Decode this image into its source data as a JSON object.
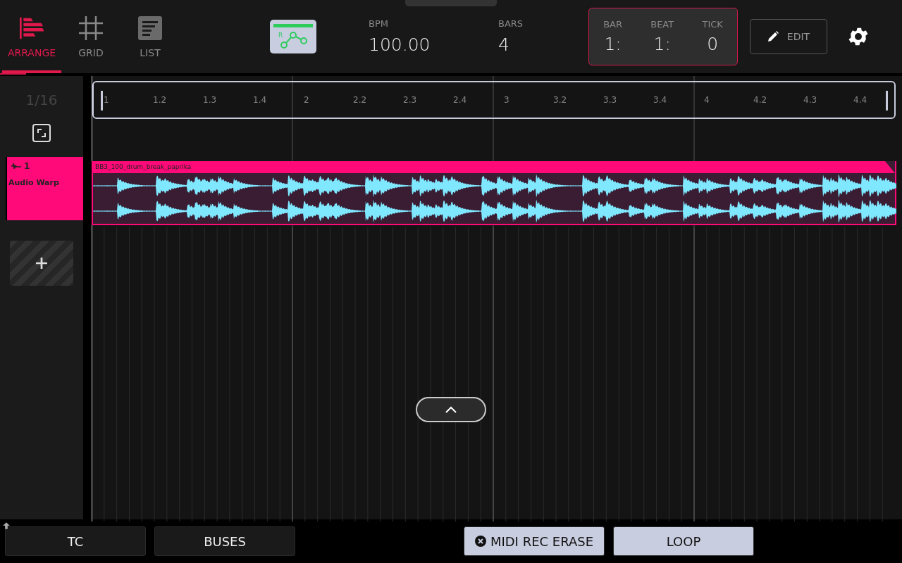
{
  "tabs": [
    {
      "label": "ARRANGE",
      "kind": "arrange",
      "selected": true
    },
    {
      "label": "GRID",
      "kind": "grid",
      "selected": false
    },
    {
      "label": "LIST",
      "kind": "list",
      "selected": false
    }
  ],
  "readouts": [
    {
      "label": "BPM",
      "value": "100.00"
    },
    {
      "label": "BARS",
      "value": "4"
    }
  ],
  "counter": [
    {
      "label": "BAR",
      "value": "1:"
    },
    {
      "label": "BEAT",
      "value": "1:"
    },
    {
      "label": "TICK",
      "value": "0"
    }
  ],
  "edit_button": {
    "label": "EDIT"
  },
  "grid_division": "1/16",
  "ruler": [
    "1",
    "1.2",
    "1.3",
    "1.4",
    "2",
    "2.2",
    "2.3",
    "2.4",
    "3",
    "3.2",
    "3.3",
    "3.4",
    "4",
    "4.2",
    "4.3",
    "4.4"
  ],
  "track": {
    "number": "1",
    "name": "Audio Warp",
    "selected": true
  },
  "clip": {
    "name": "BB3_100_drum_break_paprika"
  },
  "automation_label": "R",
  "bottom_buttons": [
    {
      "label": "TC",
      "highlighted": false,
      "kind": "plain"
    },
    {
      "label": "BUSES",
      "highlighted": false,
      "kind": "plain"
    },
    {
      "label": "MIDI REC ERASE",
      "highlighted": true,
      "kind": "clear"
    },
    {
      "label": "LOOP",
      "highlighted": true,
      "kind": "plain"
    }
  ]
}
